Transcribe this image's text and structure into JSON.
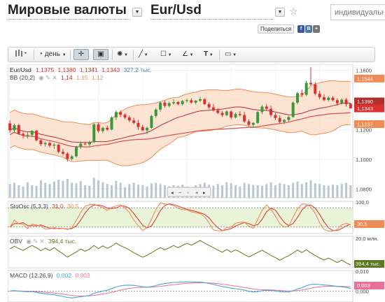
{
  "header": {
    "category": "Мировые валюты",
    "pair": "Eur/Usd",
    "search_placeholder": "индивидуальны",
    "share_label": "Поделиться",
    "share_icons": [
      "f",
      "B",
      "+"
    ]
  },
  "toolbar": {
    "period_label": "день",
    "items": [
      "bars-icon",
      "clock-icon",
      "crosshair-icon",
      "box-cursor-icon",
      "sun-icon",
      "line-tool-icon",
      "rect-tool-icon",
      "angle-tool-icon",
      "text-tool-icon",
      "image-icon"
    ]
  },
  "colors": {
    "up": "#3a9a3a",
    "down": "#d93030",
    "band_fill": "#fbd9c3",
    "band_line": "#ef8c55",
    "ma": "#b03030",
    "stoch_k": "#ef8c55",
    "stoch_d": "#d93030",
    "obv": "#5b7a1f",
    "macd": "#4aa3d8",
    "signal": "#e8709a"
  },
  "chart_data": [
    {
      "type": "candlestick",
      "title": "Eur/Usd",
      "ohlc_readout": [
        "1,1375",
        "1,1380",
        "1,1341",
        "1,1343"
      ],
      "volume_readout": "327,2 тыс.",
      "indicator_label": "BB (20,2)",
      "indicator_values": [
        "1,14",
        "1,15",
        "1,12"
      ],
      "y_ticks": [
        "1,1600",
        "1,1400",
        "1,1200",
        "1,1000",
        "1,0800"
      ],
      "ylim": [
        1.074,
        1.164
      ],
      "price_tags": [
        {
          "label": "1,1544",
          "value": 1.1544,
          "color": "#ef8c55"
        },
        {
          "label": "1,1390",
          "value": 1.139,
          "color": "#b03030"
        },
        {
          "label": "1,1343",
          "value": 1.1343,
          "color": "#d93030"
        },
        {
          "label": "1,1237",
          "value": 1.1237,
          "color": "#ef8c55"
        }
      ],
      "candles": [
        [
          1.1242,
          1.1262,
          1.1178,
          1.1195
        ],
        [
          1.1195,
          1.124,
          1.1175,
          1.123
        ],
        [
          1.123,
          1.1238,
          1.1165,
          1.1172
        ],
        [
          1.1172,
          1.1185,
          1.1142,
          1.1162
        ],
        [
          1.1162,
          1.1188,
          1.114,
          1.1165
        ],
        [
          1.1165,
          1.1196,
          1.115,
          1.1192
        ],
        [
          1.1192,
          1.1198,
          1.112,
          1.1128
        ],
        [
          1.1128,
          1.1135,
          1.109,
          1.1102
        ],
        [
          1.1102,
          1.112,
          1.1085,
          1.111
        ],
        [
          1.111,
          1.1118,
          1.108,
          1.1092
        ],
        [
          1.1092,
          1.111,
          1.107,
          1.1098
        ],
        [
          1.1098,
          1.1105,
          1.104,
          1.105
        ],
        [
          1.105,
          1.107,
          1.1025,
          1.1038
        ],
        [
          1.1038,
          1.1048,
          1.0985,
          1.1002
        ],
        [
          1.1002,
          1.103,
          1.0992,
          1.102
        ],
        [
          1.102,
          1.109,
          1.101,
          1.1082
        ],
        [
          1.1082,
          1.112,
          1.107,
          1.1105
        ],
        [
          1.1105,
          1.1118,
          1.1095,
          1.11
        ],
        [
          1.11,
          1.1125,
          1.1088,
          1.1115
        ],
        [
          1.1115,
          1.1245,
          1.111,
          1.1235
        ],
        [
          1.1235,
          1.1248,
          1.118,
          1.119
        ],
        [
          1.119,
          1.122,
          1.1175,
          1.1212
        ],
        [
          1.1212,
          1.1228,
          1.119,
          1.12
        ],
        [
          1.12,
          1.129,
          1.1195,
          1.1282
        ],
        [
          1.1282,
          1.133,
          1.1265,
          1.1318
        ],
        [
          1.1318,
          1.133,
          1.1285,
          1.13
        ],
        [
          1.13,
          1.131,
          1.127,
          1.1282
        ],
        [
          1.1282,
          1.1295,
          1.125,
          1.1262
        ],
        [
          1.1262,
          1.128,
          1.1235,
          1.1245
        ],
        [
          1.1245,
          1.1265,
          1.12,
          1.1218
        ],
        [
          1.1218,
          1.1232,
          1.119,
          1.1195
        ],
        [
          1.1195,
          1.122,
          1.1168,
          1.1212
        ],
        [
          1.1212,
          1.13,
          1.1205,
          1.1292
        ],
        [
          1.1292,
          1.1345,
          1.128,
          1.1335
        ],
        [
          1.1335,
          1.139,
          1.132,
          1.1382
        ],
        [
          1.1382,
          1.1395,
          1.1348,
          1.136
        ],
        [
          1.136,
          1.1388,
          1.135,
          1.1378
        ],
        [
          1.1378,
          1.1405,
          1.1368,
          1.1385
        ],
        [
          1.1385,
          1.1392,
          1.1365,
          1.1372
        ],
        [
          1.1372,
          1.14,
          1.1362,
          1.1392
        ],
        [
          1.1392,
          1.1408,
          1.1382,
          1.1398
        ],
        [
          1.1398,
          1.141,
          1.1375,
          1.1382
        ],
        [
          1.1382,
          1.14,
          1.137,
          1.1395
        ],
        [
          1.1395,
          1.142,
          1.1385,
          1.1405
        ],
        [
          1.1405,
          1.1412,
          1.1365,
          1.1372
        ],
        [
          1.1372,
          1.1385,
          1.134,
          1.135
        ],
        [
          1.135,
          1.1372,
          1.1322,
          1.133
        ],
        [
          1.133,
          1.1345,
          1.1305,
          1.1312
        ],
        [
          1.1312,
          1.1325,
          1.1285,
          1.1298
        ],
        [
          1.1298,
          1.133,
          1.129,
          1.1322
        ],
        [
          1.1322,
          1.133,
          1.127,
          1.1282
        ],
        [
          1.1282,
          1.1315,
          1.1275,
          1.1305
        ],
        [
          1.1305,
          1.1325,
          1.129,
          1.1298
        ],
        [
          1.1298,
          1.132,
          1.1245,
          1.1255
        ],
        [
          1.1255,
          1.1268,
          1.1222,
          1.1232
        ],
        [
          1.1232,
          1.125,
          1.1215,
          1.1245
        ],
        [
          1.1245,
          1.1325,
          1.1238,
          1.1318
        ],
        [
          1.1318,
          1.1365,
          1.1305,
          1.1355
        ],
        [
          1.1355,
          1.1372,
          1.133,
          1.134
        ],
        [
          1.134,
          1.1362,
          1.1285,
          1.1298
        ],
        [
          1.1298,
          1.1312,
          1.1265,
          1.1278
        ],
        [
          1.1278,
          1.1295,
          1.124,
          1.1252
        ],
        [
          1.1252,
          1.1272,
          1.1238,
          1.1265
        ],
        [
          1.1265,
          1.1292,
          1.1255,
          1.1285
        ],
        [
          1.1285,
          1.139,
          1.128,
          1.1382
        ],
        [
          1.1382,
          1.1455,
          1.1372,
          1.1445
        ],
        [
          1.1445,
          1.147,
          1.142,
          1.1435
        ],
        [
          1.1435,
          1.153,
          1.1425,
          1.1515
        ],
        [
          1.1515,
          1.162,
          1.1495,
          1.1505
        ],
        [
          1.1505,
          1.152,
          1.143,
          1.1442
        ],
        [
          1.1442,
          1.1462,
          1.1405,
          1.1418
        ],
        [
          1.1418,
          1.1438,
          1.139,
          1.14
        ],
        [
          1.14,
          1.1425,
          1.1388,
          1.1415
        ],
        [
          1.1415,
          1.1425,
          1.139,
          1.1398
        ],
        [
          1.1398,
          1.141,
          1.136,
          1.1378
        ],
        [
          1.1378,
          1.141,
          1.137,
          1.1402
        ],
        [
          1.1402,
          1.1412,
          1.1355,
          1.1372
        ],
        [
          1.1375,
          1.138,
          1.1341,
          1.1343
        ]
      ],
      "volume": [
        0.55,
        0.6,
        0.5,
        0.45,
        0.62,
        0.5,
        0.48,
        0.7,
        0.6,
        0.55,
        0.65,
        0.72,
        0.68,
        0.75,
        0.6,
        0.58,
        0.66,
        0.5,
        0.48,
        0.8,
        0.7,
        0.62,
        0.55,
        0.5,
        0.68,
        0.6,
        0.42,
        0.55,
        0.6,
        0.52,
        0.5,
        0.45,
        0.58,
        0.6,
        0.55,
        0.5,
        0.46,
        0.5,
        0.48,
        0.52,
        0.45,
        0.4,
        0.5,
        0.55,
        0.6,
        0.52,
        0.48,
        0.55,
        0.5,
        0.62,
        0.58,
        0.5,
        0.45,
        0.6,
        0.55,
        0.52,
        0.5,
        0.48,
        0.55,
        0.62,
        0.5,
        0.58,
        0.55,
        0.5,
        0.6,
        0.65,
        0.55,
        0.62,
        0.7,
        0.58,
        0.55,
        0.5,
        0.48,
        0.52,
        0.5,
        0.55,
        0.6,
        0.5
      ]
    },
    {
      "type": "line",
      "title": "StoOsc (5,3,3)",
      "values_readout": [
        "31,0",
        "30,5"
      ],
      "y_ticks": [
        "100,0"
      ],
      "ylim": [
        0,
        100
      ],
      "last_value_tag": "30,5",
      "levels": [
        80,
        20
      ]
    },
    {
      "type": "line",
      "title": "OBV",
      "value_readout": "394,4 тыс.",
      "y_ticks": [
        "20,0 млн."
      ],
      "last_value_tag": "394,4 тыс."
    },
    {
      "type": "line",
      "title": "MACD (12,26,9)",
      "values_readout": [
        "0,002",
        "0,003"
      ],
      "y_ticks": [
        "0,010",
        "0,000"
      ],
      "ylim": [
        -0.006,
        0.012
      ],
      "last_value_tag": "0,003"
    }
  ]
}
